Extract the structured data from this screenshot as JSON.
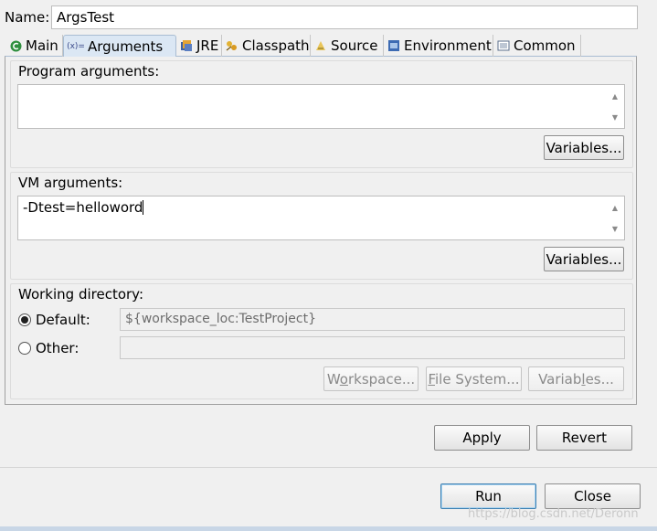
{
  "name_row": {
    "label": "Name:",
    "value": "ArgsTest"
  },
  "tabs": [
    {
      "label": "Main",
      "icon": "main-icon"
    },
    {
      "label": "Arguments",
      "icon": "arguments-icon",
      "active": true
    },
    {
      "label": "JRE",
      "icon": "jre-icon"
    },
    {
      "label": "Classpath",
      "icon": "classpath-icon"
    },
    {
      "label": "Source",
      "icon": "source-icon"
    },
    {
      "label": "Environment",
      "icon": "environment-icon"
    },
    {
      "label": "Common",
      "icon": "common-icon"
    }
  ],
  "program_args": {
    "label": "Program arguments:",
    "value": "",
    "variables_label": "Variables..."
  },
  "vm_args": {
    "label": "VM arguments:",
    "value": "-Dtest=helloword",
    "variables_label": "Variables..."
  },
  "working_dir": {
    "label": "Working directory:",
    "default_label": "Default:",
    "default_value": "${workspace_loc:TestProject}",
    "other_label": "Other:",
    "other_value": "",
    "workspace_pre": "W",
    "workspace_ul": "o",
    "workspace_post": "rkspace...",
    "filesystem_pre": "",
    "filesystem_ul": "F",
    "filesystem_post": "ile System...",
    "variables_pre": "Variab",
    "variables_ul": "l",
    "variables_post": "es..."
  },
  "actions": {
    "apply": "Apply",
    "revert": "Revert",
    "run": "Run",
    "close": "Close"
  },
  "watermark": "https://blog.csdn.net/Deronn",
  "colors": {
    "active_tab": "#dbe7f4",
    "default_button_border": "#3c7fb1"
  }
}
